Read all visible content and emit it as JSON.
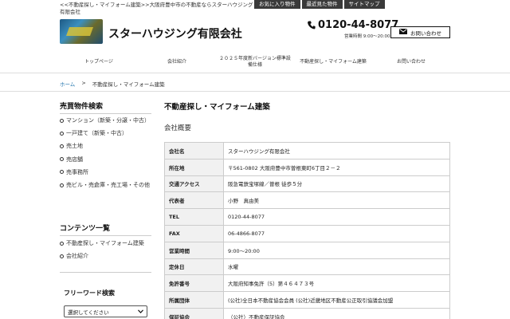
{
  "top": {
    "description": "<<不動産探し・マイフォーム建築>>大阪府豊中市の不動産ならスターハウジング有限会社",
    "links": [
      "お気に入り物件",
      "最近見た物件",
      "サイトマップ"
    ]
  },
  "header": {
    "company_name": "スターハウジング有限会社",
    "phone": "0120-44-8077",
    "hours": "営業時間 9:00〜20:00",
    "contact_label": "お問い合わせ"
  },
  "nav": {
    "items": [
      "トップページ",
      "会社紹介",
      "２０２５年度新バージョン標準設備仕様",
      "不動産探し・マイフォーム建築",
      "お問い合わせ"
    ]
  },
  "breadcrumb": {
    "home": "ホーム",
    "separator": ">",
    "current": "不動産探し・マイフォーム建築"
  },
  "sidebar": {
    "property_title": "売買物件検索",
    "property_items": [
      "マンション（新築・分譲・中古）",
      "一戸建て（新築・中古）",
      "売土地",
      "売店舗",
      "売事務所",
      "売ビル・売倉庫・売工場・その他"
    ],
    "contents_title": "コンテンツ一覧",
    "contents_items": [
      "不動産探し・マイフォーム建築",
      "会社紹介"
    ],
    "search_title": "フリーワード検索",
    "select_value": "選択してください"
  },
  "main": {
    "title": "不動産探し・マイフォーム建築",
    "subtitle": "会社概要",
    "rows": [
      {
        "k": "会社名",
        "v": "スターハウジング有限会社"
      },
      {
        "k": "所在地",
        "v": "〒561-0802 大阪府豊中市曽根東町6丁目２－２"
      },
      {
        "k": "交通アクセス",
        "v": "阪急電鉄宝塚線／曽根 徒歩５分"
      },
      {
        "k": "代表者",
        "v": "小野　真由美"
      },
      {
        "k": "TEL",
        "v": "0120-44-8077"
      },
      {
        "k": "FAX",
        "v": "06-4866-8077"
      },
      {
        "k": "営業時間",
        "v": "9:00〜20:00"
      },
      {
        "k": "定休日",
        "v": "水曜"
      },
      {
        "k": "免許番号",
        "v": "大阪府知事免許（5）第４６４７３号"
      },
      {
        "k": "所属団体",
        "v": "(公社)全日本不動産協会会員 (公社)近畿地区不動産公正取引協議会加盟"
      },
      {
        "k": "保証協会",
        "v": "（公社）不動産保証協会"
      }
    ]
  }
}
